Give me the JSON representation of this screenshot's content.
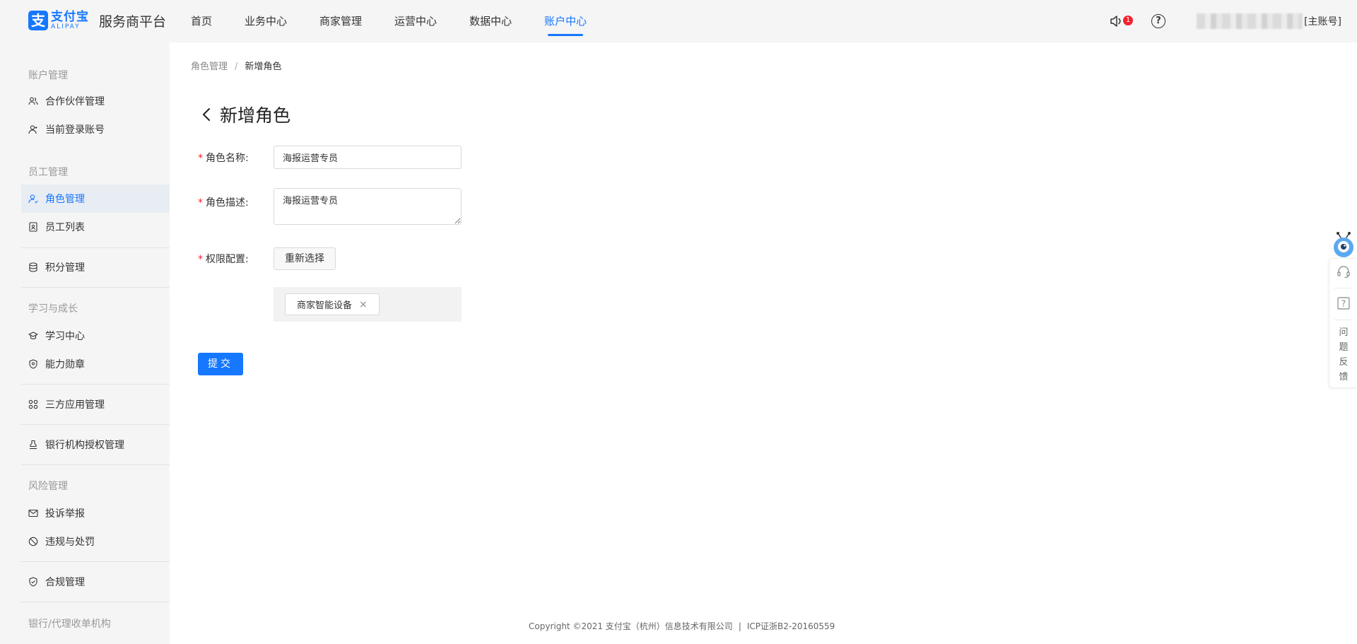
{
  "header": {
    "logo_cn": "支付宝",
    "logo_en": "ALIPAY",
    "logo_mark": "支",
    "platform": "服务商平台",
    "nav": [
      {
        "label": "首页",
        "active": false
      },
      {
        "label": "业务中心",
        "active": false
      },
      {
        "label": "商家管理",
        "active": false
      },
      {
        "label": "运营中心",
        "active": false
      },
      {
        "label": "数据中心",
        "active": false
      },
      {
        "label": "账户中心",
        "active": true
      }
    ],
    "notification_count": "1",
    "help_glyph": "?",
    "account_suffix": "[主账号]"
  },
  "sidebar": {
    "groups": {
      "account": "账户管理",
      "staff": "员工管理",
      "learning": "学习与成长",
      "risk": "风险管理",
      "bank": "银行/代理收单机构"
    },
    "items": {
      "partner": "合作伙伴管理",
      "current_account": "当前登录账号",
      "role": "角色管理",
      "staff_list": "员工列表",
      "points": "积分管理",
      "learning_center": "学习中心",
      "badge": "能力勋章",
      "third_party": "三方应用管理",
      "bank_auth": "银行机构授权管理",
      "complaint": "投诉举报",
      "violation": "违规与处罚",
      "compliance": "合规管理"
    }
  },
  "breadcrumb": {
    "parent": "角色管理",
    "separator": "/",
    "current": "新增角色"
  },
  "page": {
    "title": "新增角色"
  },
  "form": {
    "required_mark": "*",
    "name_label": "角色名称:",
    "name_value": "海报运营专员",
    "desc_label": "角色描述:",
    "desc_value": "海报运营专员",
    "perm_label": "权限配置:",
    "reselect_button": "重新选择",
    "selected_tag": "商家智能设备",
    "tag_close": "×",
    "submit_button": "提交"
  },
  "footer": {
    "copyright": "Copyright ©2021 支付宝（杭州）信息技术有限公司",
    "separator": "|",
    "icp": "ICP证浙B2-20160559"
  },
  "float_widget": {
    "feedback": "问题反馈",
    "help_glyph": "?"
  },
  "colors": {
    "primary": "#1677ff",
    "badge": "#f5222d",
    "required": "#f5222d",
    "sidebar_bg": "#f5f5f5",
    "sidebar_active_bg": "#e8ecf3"
  }
}
